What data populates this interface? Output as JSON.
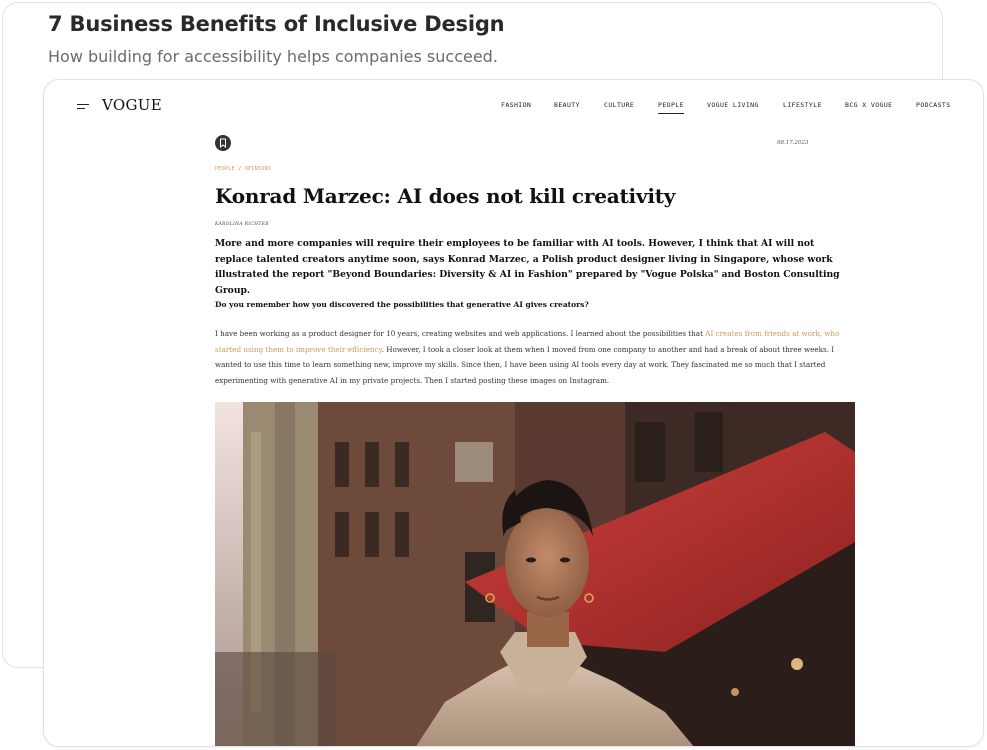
{
  "background_card": {
    "title": "7 Business Benefits of Inclusive Design",
    "subtitle": "How building for accessibility helps companies succeed."
  },
  "site": {
    "logo": "VOGUE",
    "nav": [
      {
        "label": "FASHION",
        "active": false
      },
      {
        "label": "BEAUTY",
        "active": false
      },
      {
        "label": "CULTURE",
        "active": false
      },
      {
        "label": "PEOPLE",
        "active": true
      },
      {
        "label": "VOGUE LIVING",
        "active": false
      },
      {
        "label": "LIFESTYLE",
        "active": false
      },
      {
        "label": "BCG X VOGUE",
        "active": false
      },
      {
        "label": "PODCASTS",
        "active": false
      }
    ]
  },
  "article": {
    "date": "08.17.2023",
    "breadcrumb": [
      "PEOPLE",
      "OPINIONS"
    ],
    "breadcrumb_separator": "/",
    "headline": "Konrad Marzec: AI does not kill creativity",
    "author": "KAROLINA RICHTER",
    "lead": "More and more companies will require their employees to be familiar with AI tools. However, I think that AI will not replace talented creators anytime soon, says Konrad Marzec, a Polish product designer living in Singapore, whose work illustrated the report \"Beyond Boundaries: Diversity & AI in Fashion\" prepared by \"Vogue Polska\" and Boston Consulting Group.",
    "question": "Do you remember how you discovered the possibilities that generative AI gives creators?",
    "body_before_link": "I have been working as a product designer for 10 years, creating websites and web applications. I learned about the possibilities that ",
    "body_link": "AI creates from friends at work, who started using them to improve their efficiency",
    "body_after_link": ". However, I took a closer look at them when I moved from one company to another and had a break of about three weeks. I wanted to use this time to learn something new, improve my skills. Since then, I have been using AI tools every day at work. They fascinated me so much that I started experimenting with generative AI in my private projects. Then I started posting these images on Instagram."
  },
  "colors": {
    "accent_link": "#c89d5a",
    "text_dark": "#111111",
    "awning_red": "#b8302e"
  },
  "icons": [
    "menu-icon",
    "bookmark-icon"
  ]
}
